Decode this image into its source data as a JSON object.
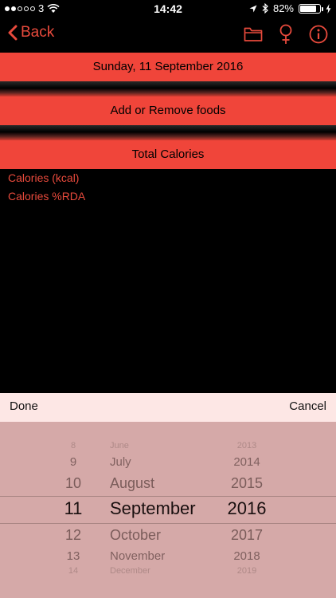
{
  "status": {
    "carrier": "3",
    "time": "14:42",
    "battery": "82%",
    "battery_level": 0.82
  },
  "nav": {
    "back_label": "Back"
  },
  "bars": {
    "date": "Sunday, 11 September 2016",
    "foods": "Add or Remove foods",
    "total": "Total Calories"
  },
  "info": {
    "kcal": "Calories (kcal)",
    "rda": "Calories %RDA"
  },
  "picker": {
    "done": "Done",
    "cancel": "Cancel",
    "rows": [
      {
        "day": "8",
        "month": "June",
        "year": "2013"
      },
      {
        "day": "9",
        "month": "July",
        "year": "2014"
      },
      {
        "day": "10",
        "month": "August",
        "year": "2015"
      },
      {
        "day": "11",
        "month": "September",
        "year": "2016"
      },
      {
        "day": "12",
        "month": "October",
        "year": "2017"
      },
      {
        "day": "13",
        "month": "November",
        "year": "2018"
      },
      {
        "day": "14",
        "month": "December",
        "year": "2019"
      }
    ]
  },
  "colors": {
    "accent": "#f0453a",
    "text_accent": "#e84a3c",
    "picker_bg": "#d5a9a8",
    "toolbar_bg": "#fde7e5"
  }
}
